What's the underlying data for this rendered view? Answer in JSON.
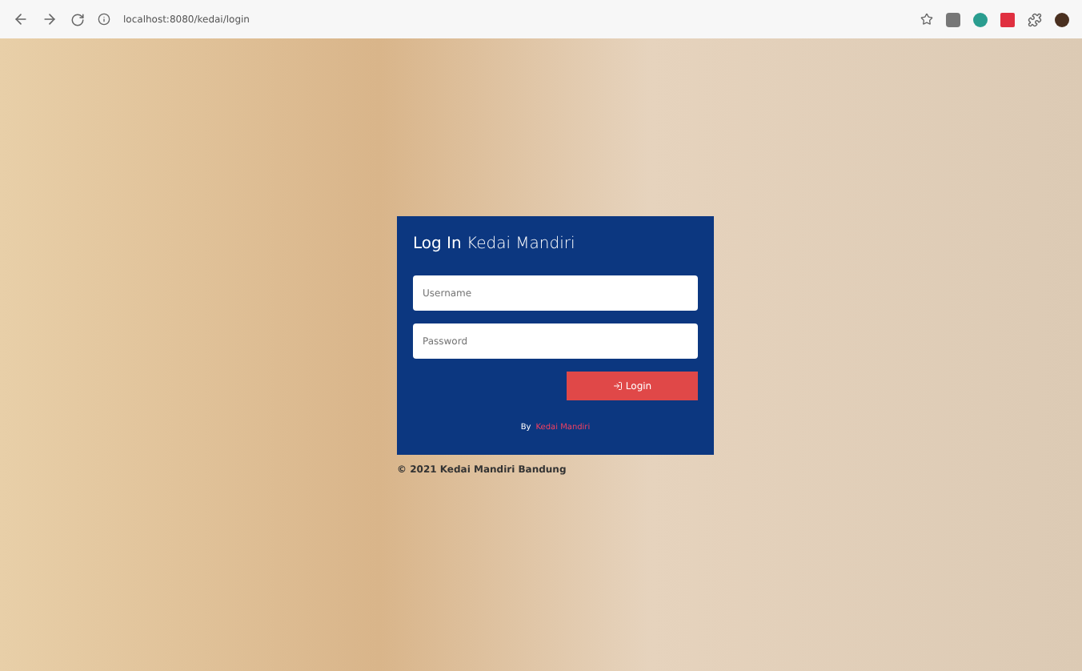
{
  "browser": {
    "url": "localhost:8080/kedai/login"
  },
  "login": {
    "title": "**Log In** Kedai Mandiri",
    "username": {
      "placeholder": "Username"
    },
    "password": {
      "placeholder": "Password"
    },
    "button": "Login",
    "credit": {
      "prefix": "By",
      "link": "Kedai Mandiri"
    }
  },
  "footer": "© 2021 Kedai Mandiri Bandung"
}
